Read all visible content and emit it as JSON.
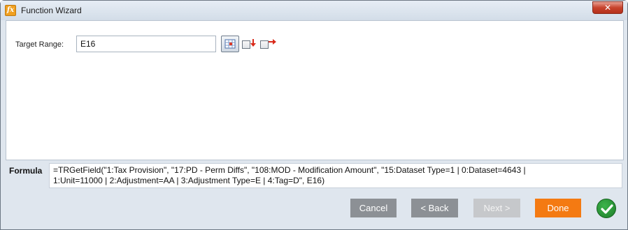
{
  "window": {
    "title": "Function Wizard",
    "app_icon": "fx-icon",
    "close_label": "✕"
  },
  "target_range": {
    "label": "Target Range:",
    "value": "E16",
    "select_button_icon": "select-range-icon",
    "options": [
      {
        "icon": "fill-down-icon",
        "checked": false
      },
      {
        "icon": "fill-right-icon",
        "checked": false
      }
    ]
  },
  "formula": {
    "label": "Formula",
    "line1": "=TRGetField(\"1:Tax Provision\", \"17:PD - Perm Diffs\", \"108:MOD - Modification Amount\", \"15:Dataset Type=1 | 0:Dataset=4643 |",
    "line2": "1:Unit=11000 | 2:Adjustment=AA | 3:Adjustment Type=E | 4:Tag=D\", E16)"
  },
  "footer": {
    "cancel_label": "Cancel",
    "back_label": "< Back",
    "next_label": "Next >",
    "done_label": "Done",
    "ok_icon": "check-circle-icon"
  },
  "colors": {
    "accent_done": "#f47a12",
    "button_gray": "#8c9095",
    "button_disabled": "#c6c8cb",
    "ok_green": "#2a9a38",
    "close_red": "#c7432d"
  }
}
